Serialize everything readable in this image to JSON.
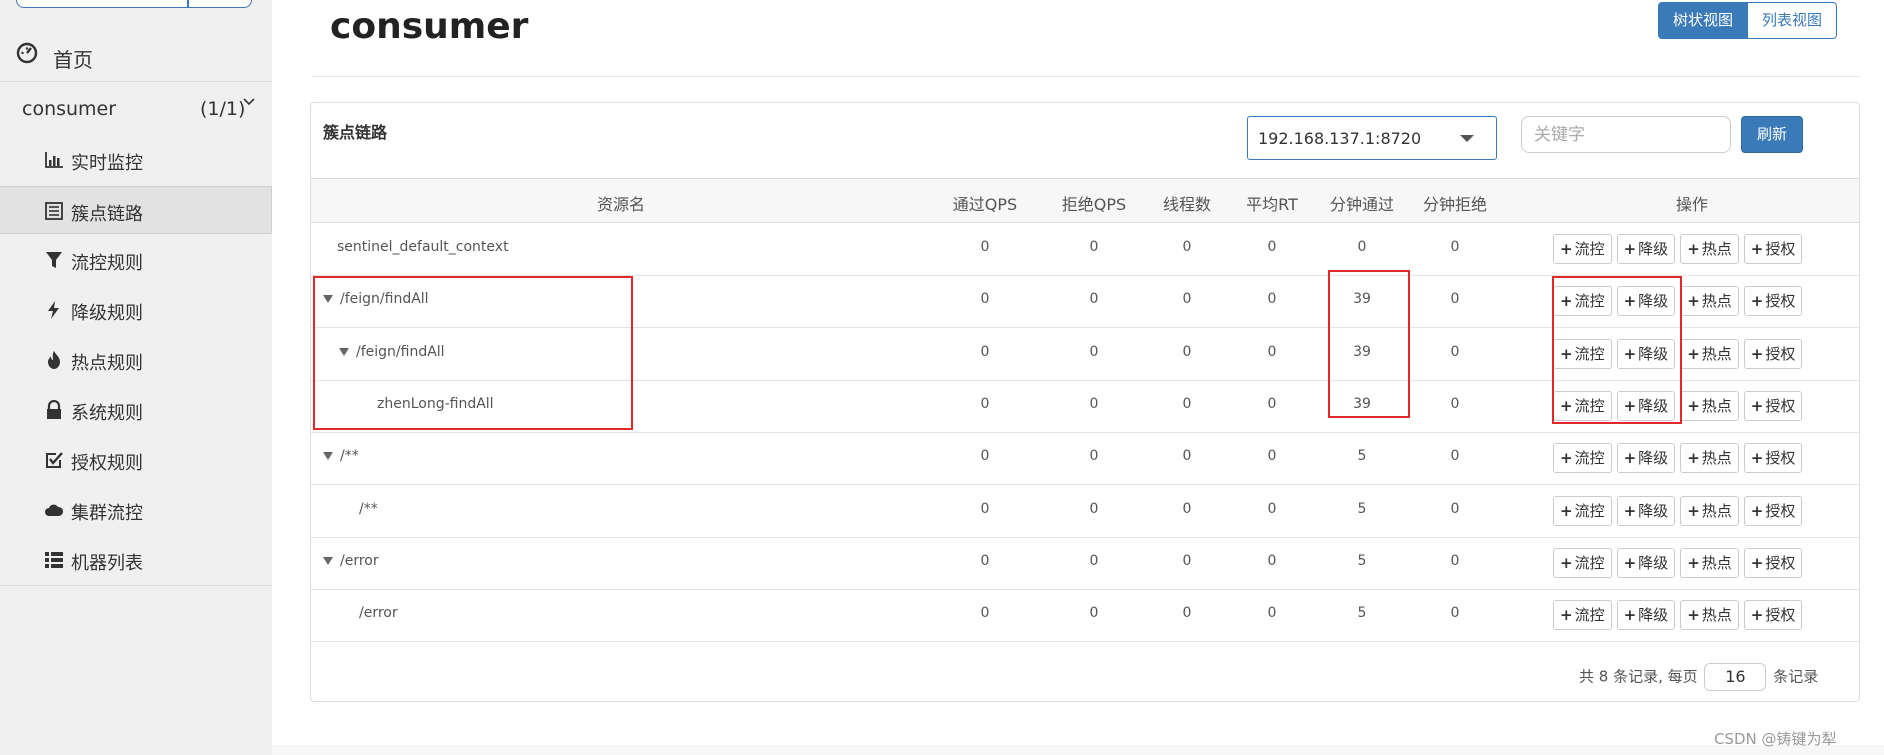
{
  "sidebar": {
    "home": "首页",
    "app": {
      "name": "consumer",
      "count": "(1/1)"
    },
    "items": [
      {
        "label": "实时监控",
        "icon": "bar-chart-icon"
      },
      {
        "label": "簇点链路",
        "icon": "list-icon"
      },
      {
        "label": "流控规则",
        "icon": "filter-icon"
      },
      {
        "label": "降级规则",
        "icon": "bolt-icon"
      },
      {
        "label": "热点规则",
        "icon": "fire-icon"
      },
      {
        "label": "系统规则",
        "icon": "lock-icon"
      },
      {
        "label": "授权规则",
        "icon": "check-square-icon"
      },
      {
        "label": "集群流控",
        "icon": "cloud-icon"
      },
      {
        "label": "机器列表",
        "icon": "th-list-icon"
      }
    ]
  },
  "header": {
    "title": "consumer",
    "view_tree": "树状视图",
    "view_list": "列表视图"
  },
  "panel": {
    "title": "簇点链路",
    "machine": "192.168.137.1:8720",
    "search_placeholder": "关键字",
    "refresh": "刷新"
  },
  "table": {
    "columns": [
      "资源名",
      "通过QPS",
      "拒绝QPS",
      "线程数",
      "平均RT",
      "分钟通过",
      "分钟拒绝",
      "操作"
    ],
    "op_buttons": [
      "流控",
      "降级",
      "热点",
      "授权"
    ],
    "rows": [
      {
        "name": "sentinel_default_context",
        "pass_qps": "0",
        "block_qps": "0",
        "threads": "0",
        "avg_rt": "0",
        "minute_pass": "0",
        "minute_block": "0"
      },
      {
        "name": "/feign/findAll",
        "pass_qps": "0",
        "block_qps": "0",
        "threads": "0",
        "avg_rt": "0",
        "minute_pass": "39",
        "minute_block": "0"
      },
      {
        "name": "/feign/findAll",
        "pass_qps": "0",
        "block_qps": "0",
        "threads": "0",
        "avg_rt": "0",
        "minute_pass": "39",
        "minute_block": "0"
      },
      {
        "name": "zhenLong-findAll",
        "pass_qps": "0",
        "block_qps": "0",
        "threads": "0",
        "avg_rt": "0",
        "minute_pass": "39",
        "minute_block": "0"
      },
      {
        "name": "/**",
        "pass_qps": "0",
        "block_qps": "0",
        "threads": "0",
        "avg_rt": "0",
        "minute_pass": "5",
        "minute_block": "0"
      },
      {
        "name": "/**",
        "pass_qps": "0",
        "block_qps": "0",
        "threads": "0",
        "avg_rt": "0",
        "minute_pass": "5",
        "minute_block": "0"
      },
      {
        "name": "/error",
        "pass_qps": "0",
        "block_qps": "0",
        "threads": "0",
        "avg_rt": "0",
        "minute_pass": "5",
        "minute_block": "0"
      },
      {
        "name": "/error",
        "pass_qps": "0",
        "block_qps": "0",
        "threads": "0",
        "avg_rt": "0",
        "minute_pass": "5",
        "minute_block": "0"
      }
    ]
  },
  "pager": {
    "prefix": "共 8 条记录, 每页",
    "page_size": "16",
    "suffix": "条记录"
  },
  "watermark": "CSDN @铸键为犁",
  "colors": {
    "accent": "#3a7ab8",
    "highlight": "#e02a2a"
  }
}
